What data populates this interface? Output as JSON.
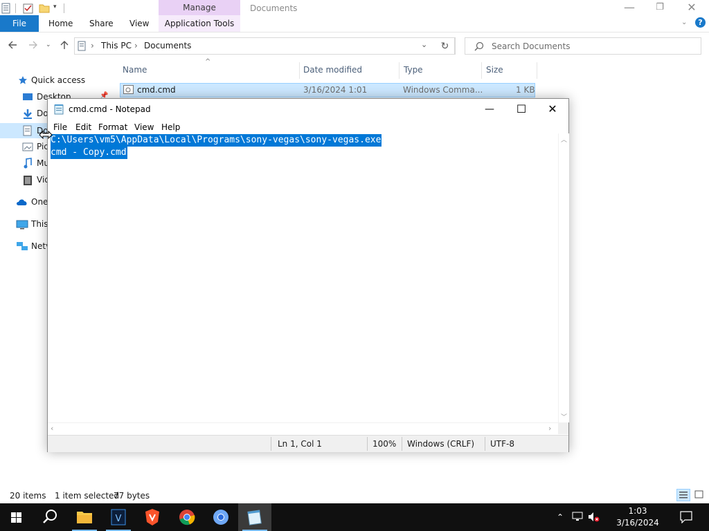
{
  "explorer": {
    "title": "Documents",
    "context_tab_group": "Manage",
    "ribbon_tabs": {
      "file": "File",
      "home": "Home",
      "share": "Share",
      "view": "View",
      "app_tools": "Application Tools"
    },
    "window_controls": {
      "minimize": "—",
      "maximize": "❐",
      "close": "✕"
    },
    "breadcrumb": [
      "This PC",
      "Documents"
    ],
    "search_placeholder": "Search Documents",
    "nav_pane": {
      "quick_access": "Quick access",
      "items": [
        "Desktop",
        "Do",
        "Do",
        "Pic",
        "Mu",
        "Vid",
        "One",
        "This",
        "Netv"
      ]
    },
    "columns": {
      "name": "Name",
      "date": "Date modified",
      "type": "Type",
      "size": "Size"
    },
    "files": [
      {
        "name": "cmd.cmd",
        "date": "3/16/2024 1:01",
        "type": "Windows Comma...",
        "size": "1 KB"
      }
    ],
    "status": {
      "count": "20 items",
      "selection": "1 item selected",
      "bytes": "77 bytes"
    }
  },
  "notepad": {
    "title": "cmd.cmd - Notepad",
    "menu": [
      "File",
      "Edit",
      "Format",
      "View",
      "Help"
    ],
    "lines": [
      "C:\\Users\\vm5\\AppData\\Local\\Programs\\sony-vegas\\sony-vegas.exe",
      "cmd - Copy.cmd"
    ],
    "status": {
      "position": "Ln 1, Col 1",
      "zoom": "100%",
      "eol": "Windows (CRLF)",
      "encoding": "UTF-8"
    },
    "controls": {
      "minimize": "—",
      "maximize": "☐",
      "close": "✕"
    }
  },
  "taskbar": {
    "clock_time": "1:03",
    "clock_date": "3/16/2024",
    "apps": [
      "start",
      "search",
      "file-explorer",
      "vegas",
      "brave",
      "chrome",
      "chromium",
      "notepad"
    ]
  },
  "colors": {
    "accent": "#0078d7",
    "file_tab": "#1979ca",
    "manage_tab": "#e9d1f5",
    "selection": "#cce8ff"
  }
}
